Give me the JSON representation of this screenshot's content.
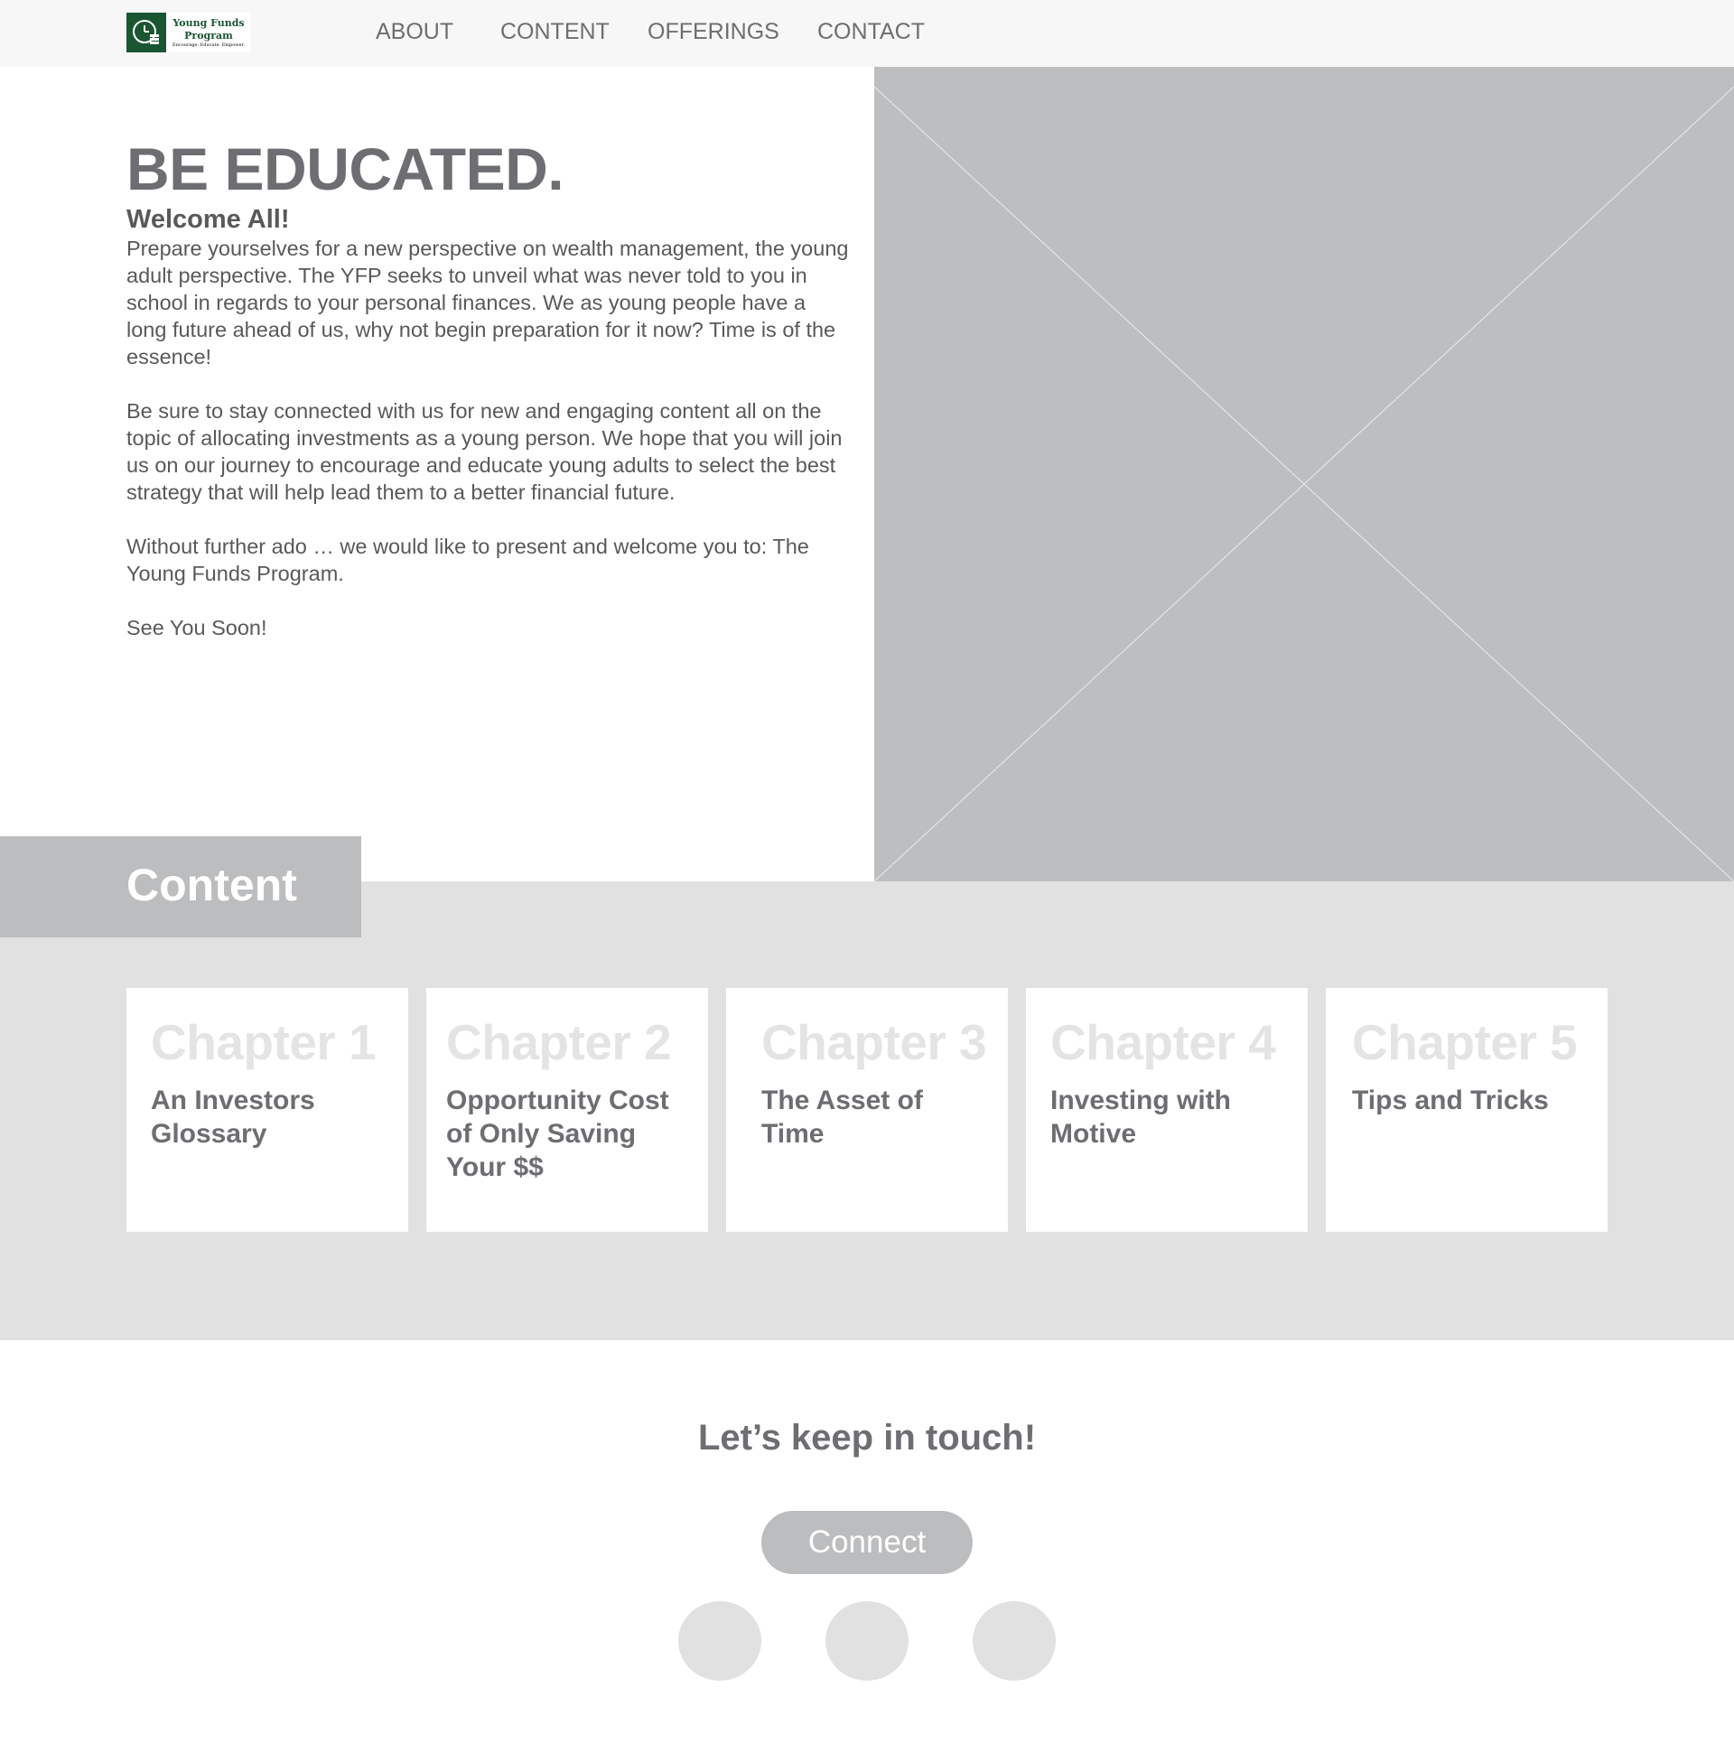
{
  "colors": {
    "header_bg": "#f7f7f7",
    "text_gray": "#6d6e71",
    "text_dark_gray": "#58595b",
    "placeholder_gray": "#bdbec0",
    "section_bg": "#e1e1e1",
    "brand_green": "#1a5632"
  },
  "header": {
    "logo": {
      "name": "Young Funds Program",
      "tagline": "Encourage. Educate. Empower.",
      "icon": "clock-coins-icon"
    },
    "nav": [
      {
        "label": "ABOUT"
      },
      {
        "label": "CONTENT"
      },
      {
        "label": "OFFERINGS"
      },
      {
        "label": "CONTACT"
      }
    ]
  },
  "hero": {
    "title": "BE EDUCATED.",
    "subtitle": "Welcome All!",
    "paragraphs": [
      "Prepare yourselves for a new perspective on wealth management, the young adult perspective. The YFP seeks to unveil what was never told to you in school in regards to your personal finances. We as young people have a long future ahead of us, why not begin preparation for it now? Time is of the essence!",
      "Be sure to stay connected with us for new and engaging content all on the topic of allocating investments as a young person. We hope that you will join us on our journey to encourage and educate young adults to select the best strategy that will help lead them to a better financial future.",
      "Without further ado … we would like to present and welcome you to: The Young Funds Program.",
      "See You Soon!"
    ],
    "image_icon": "image-placeholder-icon"
  },
  "content_section": {
    "heading": "Content",
    "cards": [
      {
        "chapter": "Chapter 1",
        "title": "An Investors Glossary"
      },
      {
        "chapter": "Chapter 2",
        "title": "Opportunity Cost of Only Saving Your $$"
      },
      {
        "chapter": "Chapter 3",
        "title": "The Asset of Time"
      },
      {
        "chapter": "Chapter 4",
        "title": "Investing with Motive"
      },
      {
        "chapter": "Chapter 5",
        "title": "Tips and Tricks"
      }
    ]
  },
  "contact": {
    "heading": "Let’s keep in touch!",
    "button_label": "Connect",
    "social_icons": [
      "social-icon",
      "social-icon",
      "social-icon"
    ]
  }
}
